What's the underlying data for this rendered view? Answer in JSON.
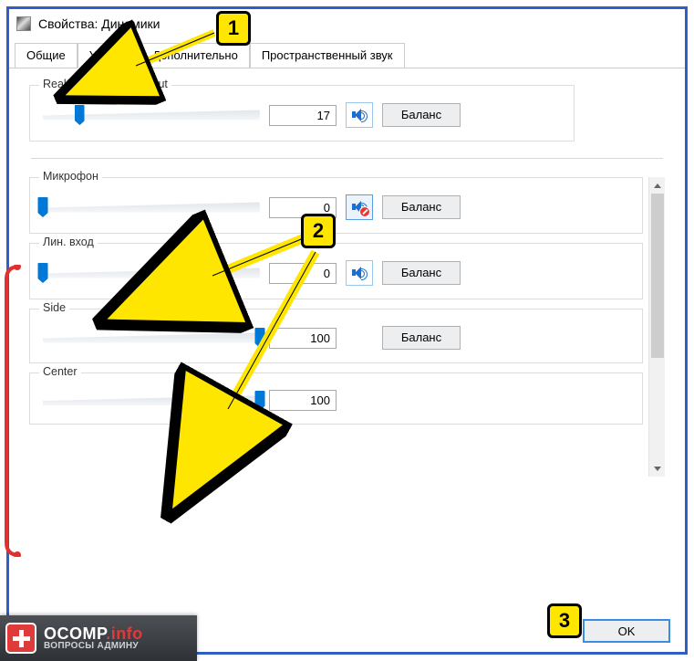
{
  "window": {
    "title": "Свойства: Динамики"
  },
  "tabs": {
    "items": [
      "Общие",
      "Уровни",
      "Дополнительно",
      "Пространственный звук"
    ],
    "active_index": 1
  },
  "output": {
    "label": "Realtek HD Audio output",
    "value": 17,
    "muted": false,
    "balance_label": "Баланс"
  },
  "inputs": [
    {
      "label": "Микрофон",
      "value": 0,
      "muted": true,
      "balance_label": "Баланс",
      "show_icon": true
    },
    {
      "label": "Лин. вход",
      "value": 0,
      "muted": false,
      "balance_label": "Баланс",
      "show_icon": true
    },
    {
      "label": "Side",
      "value": 100,
      "muted": false,
      "balance_label": "Баланс",
      "show_icon": false
    },
    {
      "label": "Center",
      "value": 100,
      "muted": false,
      "balance_label": "",
      "show_icon": false
    }
  ],
  "buttons": {
    "ok": "OK"
  },
  "annotations": {
    "markers": [
      "1",
      "2",
      "3"
    ]
  },
  "logo": {
    "brand": "OCOMP",
    "tld": ".info",
    "tagline": "ВОПРОСЫ АДМИНУ"
  }
}
